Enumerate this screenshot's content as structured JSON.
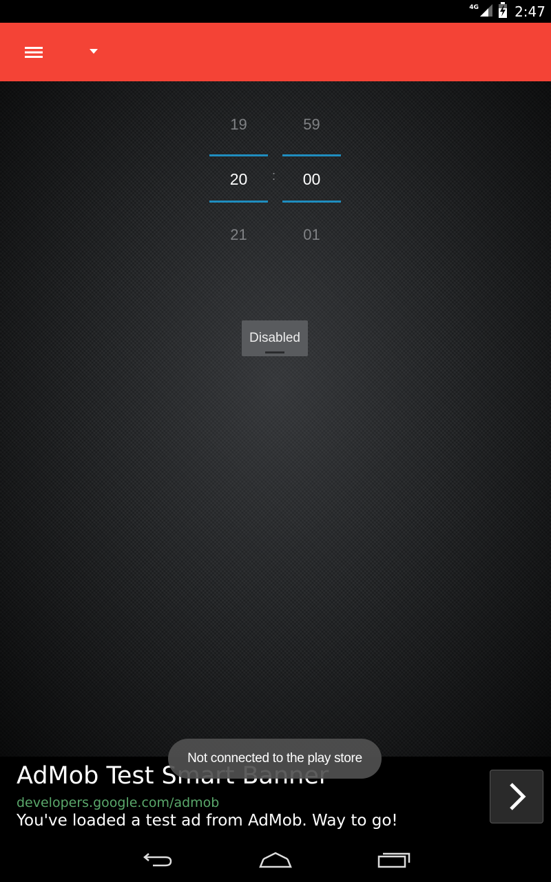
{
  "status_bar": {
    "network": "4G",
    "time": "2:47"
  },
  "icons": {
    "menu": "menu-icon",
    "dropdown": "dropdown-arrow-icon",
    "signal": "signal-icon",
    "battery": "battery-icon",
    "ad_next": "chevron-right-icon",
    "nav_back": "back-icon",
    "nav_home": "home-icon",
    "nav_recents": "recents-icon"
  },
  "colors": {
    "app_bar": "#f44336",
    "picker_accent": "#1f8dbf",
    "ad_url": "#5aa86b"
  },
  "time_picker": {
    "hour": {
      "prev": "19",
      "selected": "20",
      "next": "21"
    },
    "separator": ":",
    "minute": {
      "prev": "59",
      "selected": "00",
      "next": "01"
    }
  },
  "toggle": {
    "label": "Disabled"
  },
  "ad": {
    "title": "AdMob Test Smart Banner",
    "url": "developers.google.com/admob",
    "description": "You've loaded a test ad from AdMob. Way to go!"
  },
  "toast": {
    "message": "Not connected to the play store"
  }
}
